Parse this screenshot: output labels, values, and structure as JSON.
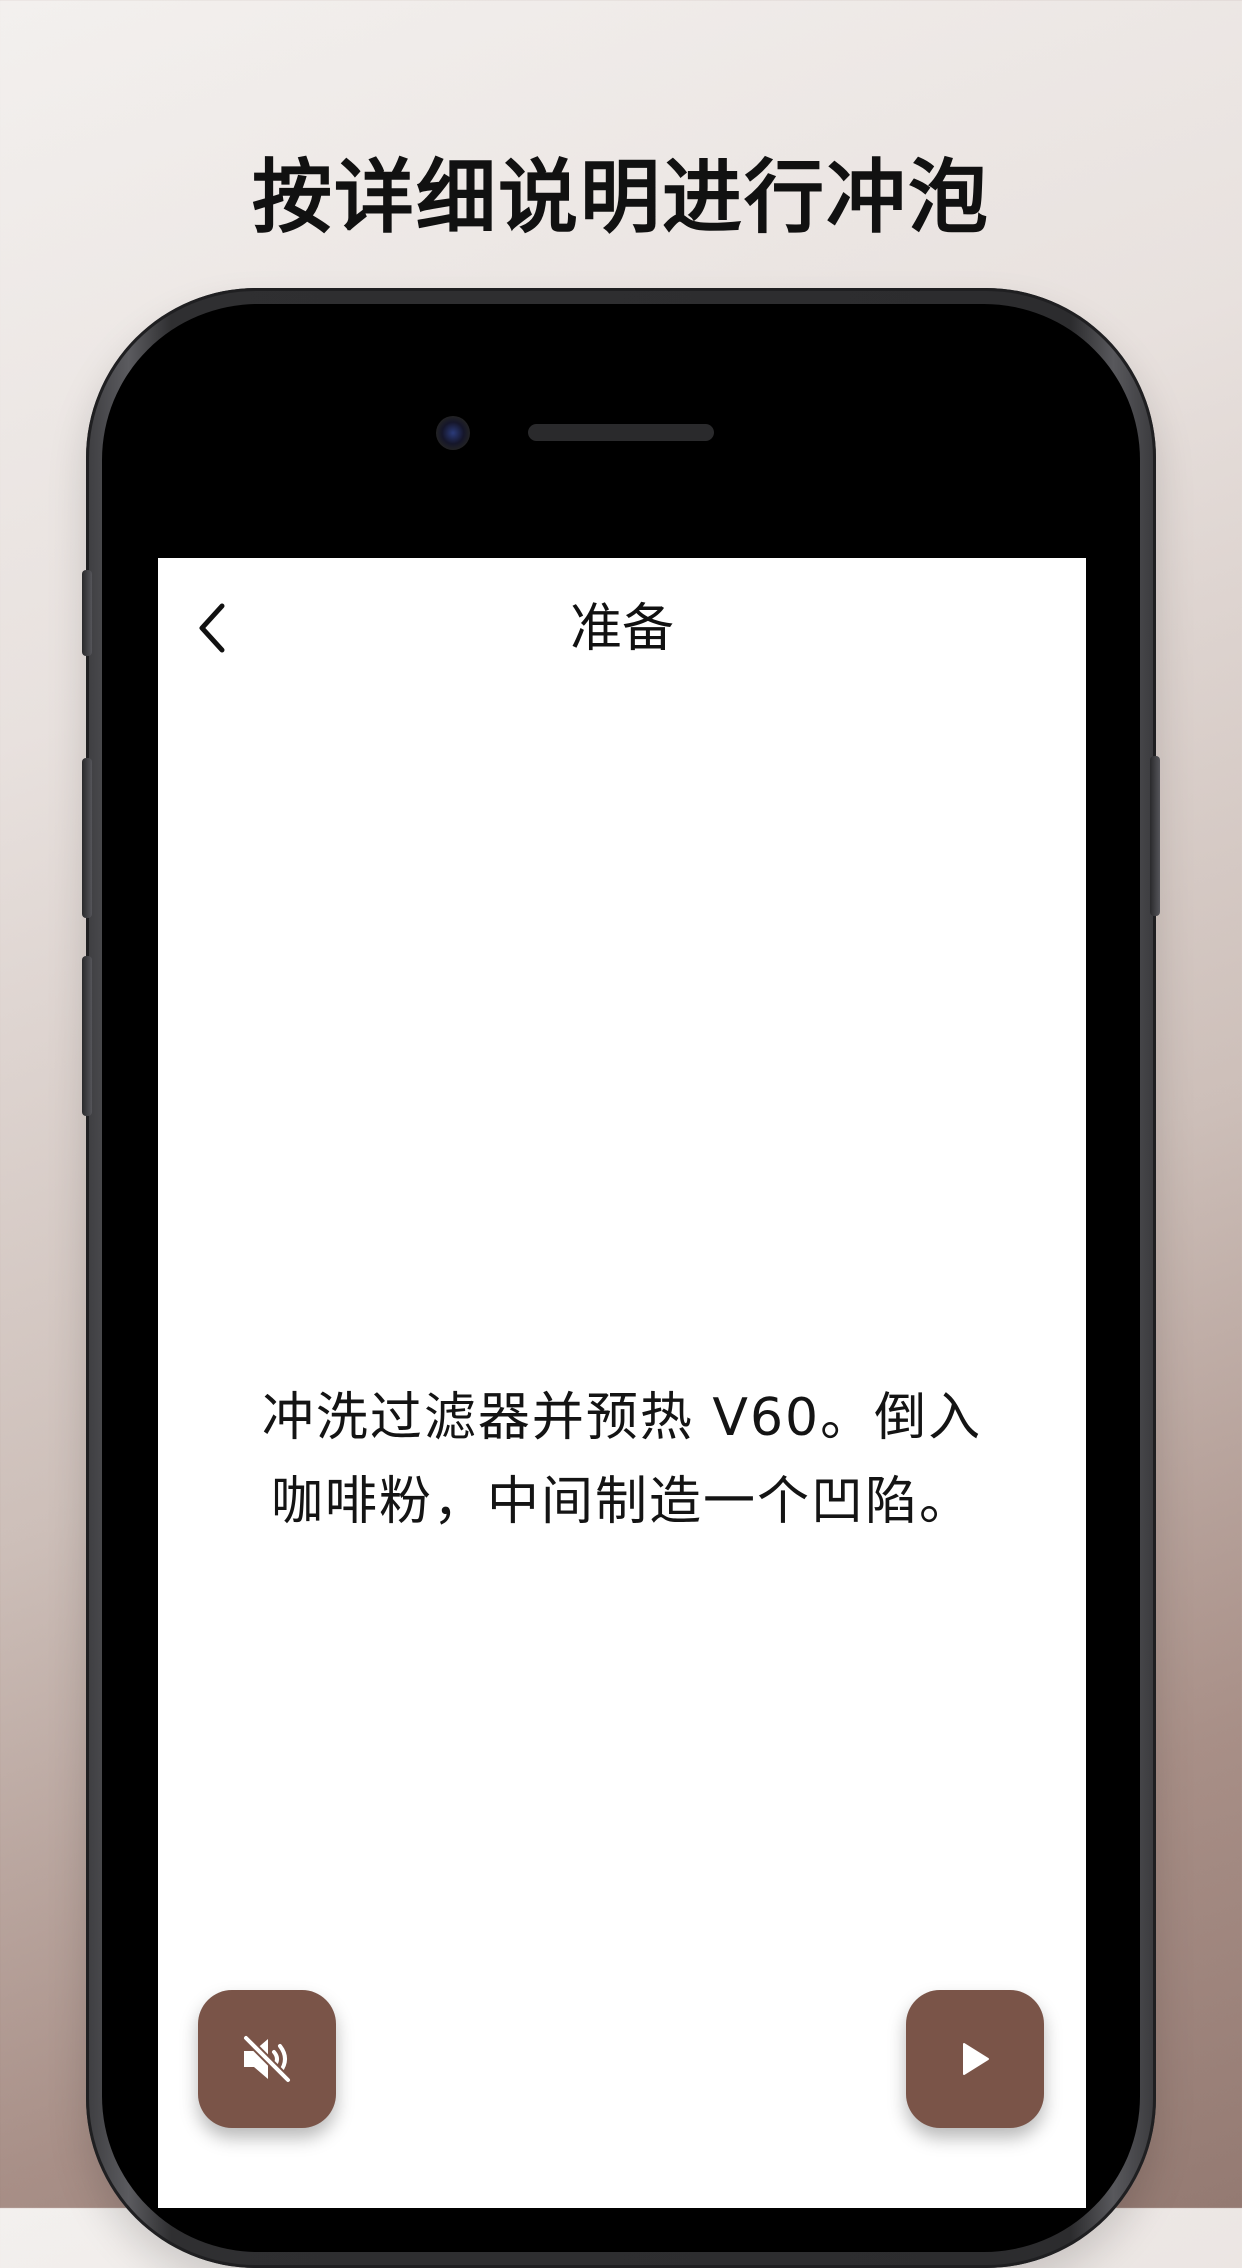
{
  "headline": "按详细说明进行冲泡",
  "screen": {
    "nav": {
      "title": "准备",
      "back_icon": "chevron-left-icon"
    },
    "instruction_lines": [
      "冲洗过滤器并预热 V60。倒入",
      "咖啡粉，中间制造一个凹陷。"
    ],
    "buttons": {
      "mute_icon": "speaker-muted-icon",
      "play_icon": "play-icon"
    }
  },
  "colors": {
    "accent": "#7a5448",
    "screen_bg": "#ffffff",
    "text": "#111111"
  }
}
